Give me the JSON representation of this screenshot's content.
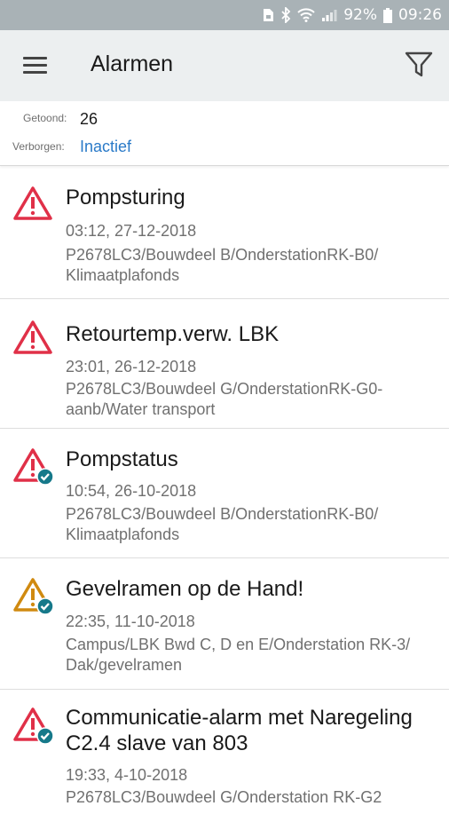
{
  "status_bar": {
    "battery": "92%",
    "time": "09:26",
    "icons": [
      "sim-icon",
      "bluetooth-icon",
      "wifi-icon",
      "signal-icon",
      "battery-icon"
    ]
  },
  "app_bar": {
    "title": "Alarmen",
    "menu_icon": "hamburger-menu-icon",
    "filter_icon": "filter-icon"
  },
  "summary": {
    "shown_label": "Getoond:",
    "shown_value": "26",
    "hidden_label": "Verborgen:",
    "hidden_value": "Inactief"
  },
  "colors": {
    "alarm_red": "#e03048",
    "alarm_amber": "#d08a10",
    "ack_teal": "#16798a",
    "link_blue": "#2a7ac8"
  },
  "alarms": [
    {
      "name": "Pompsturing",
      "time": "03:12, 27-12-2018",
      "path_line1": "P2678LC3/Bouwdeel B/OnderstationRK-B0/",
      "path_line2": "Klimaatplafonds",
      "severity": "red",
      "acknowledged": false
    },
    {
      "name": "Retourtemp.verw. LBK",
      "time": "23:01, 26-12-2018",
      "path_line1": "P2678LC3/Bouwdeel G/OnderstationRK-G0-",
      "path_line2": "aanb/Water transport",
      "severity": "red",
      "acknowledged": false
    },
    {
      "name": "Pompstatus",
      "time": "10:54, 26-10-2018",
      "path_line1": "P2678LC3/Bouwdeel B/OnderstationRK-B0/",
      "path_line2": "Klimaatplafonds",
      "severity": "red",
      "acknowledged": true
    },
    {
      "name": "Gevelramen op de Hand!",
      "time": "22:35, 11-10-2018",
      "path_line1": "Campus/LBK Bwd C, D en E/Onderstation RK-3/",
      "path_line2": "Dak/gevelramen",
      "severity": "amber",
      "acknowledged": true
    },
    {
      "name_line1": "Communicatie-alarm met Naregeling",
      "name_line2": "C2.4 slave van 803",
      "time": "19:33, 4-10-2018",
      "path_line1": "P2678LC3/Bouwdeel G/Onderstation RK-G2",
      "severity": "red",
      "acknowledged": true
    }
  ]
}
